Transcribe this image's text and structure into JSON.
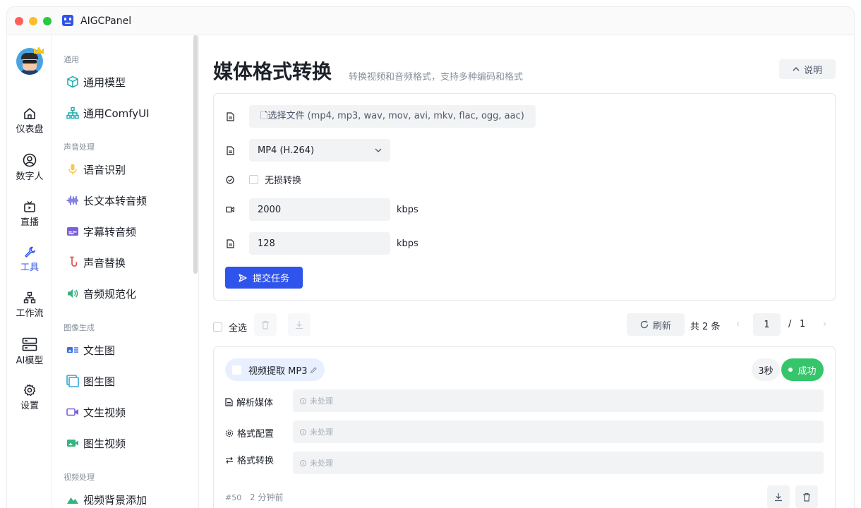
{
  "app": {
    "title": "AIGCPanel"
  },
  "rail": {
    "items": [
      {
        "label": "仪表盘"
      },
      {
        "label": "数字人"
      },
      {
        "label": "直播"
      },
      {
        "label": "工具"
      },
      {
        "label": "工作流"
      },
      {
        "label": "AI模型"
      },
      {
        "label": "设置"
      }
    ],
    "active_color": "#2f54eb"
  },
  "menu": {
    "groups": [
      {
        "label": "通用",
        "items": [
          {
            "label": "通用模型"
          },
          {
            "label": "通用ComfyUI"
          }
        ]
      },
      {
        "label": "声音处理",
        "items": [
          {
            "label": "语音识别"
          },
          {
            "label": "长文本转音频"
          },
          {
            "label": "字幕转音频"
          },
          {
            "label": "声音替换"
          },
          {
            "label": "音频规范化"
          }
        ]
      },
      {
        "label": "图像生成",
        "items": [
          {
            "label": "文生图"
          },
          {
            "label": "图生图"
          },
          {
            "label": "文生视频"
          },
          {
            "label": "图生视频"
          }
        ]
      },
      {
        "label": "视频处理",
        "items": [
          {
            "label": "视频背景添加"
          }
        ]
      }
    ]
  },
  "page": {
    "title": "媒体格式转换",
    "subtitle": "转换视频和音频格式，支持多种编码和格式",
    "help_label": "说明"
  },
  "form": {
    "file_button": "🗋选择文件 (mp4, mp3, wav, mov, avi, mkv, flac, ogg, aac)",
    "format_value": "MP4 (H.264)",
    "lossless_label": "无损转换",
    "video_bitrate": "2000",
    "audio_bitrate": "128",
    "unit": "kbps",
    "submit_label": "提交任务"
  },
  "toolbar": {
    "select_all": "全选",
    "refresh": "刷新",
    "total": "共 2 条",
    "page_current": "1",
    "page_sep": "/",
    "page_total": "1"
  },
  "task": {
    "title": "视频提取 MP3",
    "duration": "3秒",
    "status": "成功",
    "status_color": "#36c56b",
    "steps": [
      {
        "label": "解析媒体",
        "value": "未处理"
      },
      {
        "label": "格式配置",
        "value": "未处理"
      },
      {
        "label": "格式转换",
        "value": "未处理"
      }
    ],
    "id": "#50",
    "time": "2 分钟前"
  }
}
